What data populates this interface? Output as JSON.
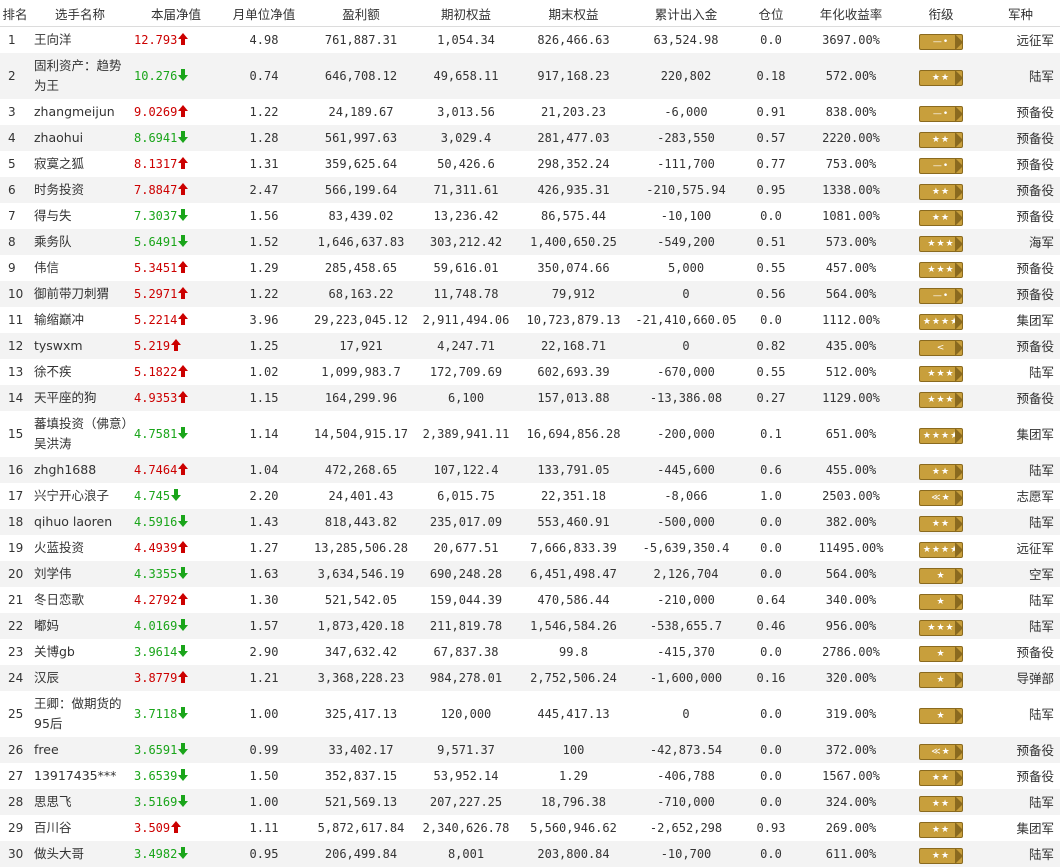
{
  "headers": [
    "排名",
    "选手名称",
    "本届净值",
    "月单位净值",
    "盈利额",
    "期初权益",
    "期末权益",
    "累计出入金",
    "仓位",
    "年化收益率",
    "衔级",
    "军种"
  ],
  "colors": {
    "up": "#cc0000",
    "down": "#1aa51a",
    "badge": "#c89f3c"
  },
  "rows": [
    {
      "rank": "1",
      "name": "王向洋",
      "nav": "12.793",
      "dir": "up",
      "monthly": "4.98",
      "profit": "761,887.31",
      "start": "1,054.34",
      "end": "826,466.63",
      "flow": "63,524.98",
      "position": "0.0",
      "annual": "3697.00%",
      "badge": "—•",
      "service": "远征军"
    },
    {
      "rank": "2",
      "name": "固利资产：趋势为王",
      "nav": "10.276",
      "dir": "down",
      "monthly": "0.74",
      "profit": "646,708.12",
      "start": "49,658.11",
      "end": "917,168.23",
      "flow": "220,802",
      "position": "0.18",
      "annual": "572.00%",
      "badge": "★★",
      "service": "陆军"
    },
    {
      "rank": "3",
      "name": "zhangmeijun",
      "nav": "9.0269",
      "dir": "up",
      "monthly": "1.22",
      "profit": "24,189.67",
      "start": "3,013.56",
      "end": "21,203.23",
      "flow": "-6,000",
      "position": "0.91",
      "annual": "838.00%",
      "badge": "—•",
      "service": "预备役"
    },
    {
      "rank": "4",
      "name": "zhaohui",
      "nav": "8.6941",
      "dir": "down",
      "monthly": "1.28",
      "profit": "561,997.63",
      "start": "3,029.4",
      "end": "281,477.03",
      "flow": "-283,550",
      "position": "0.57",
      "annual": "2220.00%",
      "badge": "★★",
      "service": "预备役"
    },
    {
      "rank": "5",
      "name": "寂寞之狐",
      "nav": "8.1317",
      "dir": "up",
      "monthly": "1.31",
      "profit": "359,625.64",
      "start": "50,426.6",
      "end": "298,352.24",
      "flow": "-111,700",
      "position": "0.77",
      "annual": "753.00%",
      "badge": "—•",
      "service": "预备役"
    },
    {
      "rank": "6",
      "name": "时务投资",
      "nav": "7.8847",
      "dir": "up",
      "monthly": "2.47",
      "profit": "566,199.64",
      "start": "71,311.61",
      "end": "426,935.31",
      "flow": "-210,575.94",
      "position": "0.95",
      "annual": "1338.00%",
      "badge": "★★",
      "service": "预备役"
    },
    {
      "rank": "7",
      "name": "得与失",
      "nav": "7.3037",
      "dir": "down",
      "monthly": "1.56",
      "profit": "83,439.02",
      "start": "13,236.42",
      "end": "86,575.44",
      "flow": "-10,100",
      "position": "0.0",
      "annual": "1081.00%",
      "badge": "★★",
      "service": "预备役"
    },
    {
      "rank": "8",
      "name": "乘务队",
      "nav": "5.6491",
      "dir": "down",
      "monthly": "1.52",
      "profit": "1,646,637.83",
      "start": "303,212.42",
      "end": "1,400,650.25",
      "flow": "-549,200",
      "position": "0.51",
      "annual": "573.00%",
      "badge": "★★★",
      "service": "海军"
    },
    {
      "rank": "9",
      "name": "伟信",
      "nav": "5.3451",
      "dir": "up",
      "monthly": "1.29",
      "profit": "285,458.65",
      "start": "59,616.01",
      "end": "350,074.66",
      "flow": "5,000",
      "position": "0.55",
      "annual": "457.00%",
      "badge": "★★★",
      "service": "预备役"
    },
    {
      "rank": "10",
      "name": "御前带刀刺猬",
      "nav": "5.2971",
      "dir": "up",
      "monthly": "1.22",
      "profit": "68,163.22",
      "start": "11,748.78",
      "end": "79,912",
      "flow": "0",
      "position": "0.56",
      "annual": "564.00%",
      "badge": "—•",
      "service": "预备役"
    },
    {
      "rank": "11",
      "name": "输缩巅冲",
      "nav": "5.2214",
      "dir": "up",
      "monthly": "3.96",
      "profit": "29,223,045.12",
      "start": "2,911,494.06",
      "end": "10,723,879.13",
      "flow": "-21,410,660.05",
      "position": "0.0",
      "annual": "1112.00%",
      "badge": "★★★★",
      "service": "集团军"
    },
    {
      "rank": "12",
      "name": "tyswxm",
      "nav": "5.219",
      "dir": "up",
      "monthly": "1.25",
      "profit": "17,921",
      "start": "4,247.71",
      "end": "22,168.71",
      "flow": "0",
      "position": "0.82",
      "annual": "435.00%",
      "badge": "<",
      "service": "预备役"
    },
    {
      "rank": "13",
      "name": "徐不疾",
      "nav": "5.1822",
      "dir": "up",
      "monthly": "1.02",
      "profit": "1,099,983.7",
      "start": "172,709.69",
      "end": "602,693.39",
      "flow": "-670,000",
      "position": "0.55",
      "annual": "512.00%",
      "badge": "★★★",
      "service": "陆军"
    },
    {
      "rank": "14",
      "name": "天平座的狗",
      "nav": "4.9353",
      "dir": "up",
      "monthly": "1.15",
      "profit": "164,299.96",
      "start": "6,100",
      "end": "157,013.88",
      "flow": "-13,386.08",
      "position": "0.27",
      "annual": "1129.00%",
      "badge": "★★★",
      "service": "预备役"
    },
    {
      "rank": "15",
      "name": "蕃填投资（佛意）吴洪涛",
      "nav": "4.7581",
      "dir": "down",
      "monthly": "1.14",
      "profit": "14,504,915.17",
      "start": "2,389,941.11",
      "end": "16,694,856.28",
      "flow": "-200,000",
      "position": "0.1",
      "annual": "651.00%",
      "badge": "★★★★",
      "service": "集团军"
    },
    {
      "rank": "16",
      "name": "zhgh1688",
      "nav": "4.7464",
      "dir": "up",
      "monthly": "1.04",
      "profit": "472,268.65",
      "start": "107,122.4",
      "end": "133,791.05",
      "flow": "-445,600",
      "position": "0.6",
      "annual": "455.00%",
      "badge": "★★",
      "service": "陆军"
    },
    {
      "rank": "17",
      "name": "兴宁开心浪子",
      "nav": "4.745",
      "dir": "down",
      "monthly": "2.20",
      "profit": "24,401.43",
      "start": "6,015.75",
      "end": "22,351.18",
      "flow": "-8,066",
      "position": "1.0",
      "annual": "2503.00%",
      "badge": "≪★",
      "service": "志愿军"
    },
    {
      "rank": "18",
      "name": "qihuo laoren",
      "nav": "4.5916",
      "dir": "down",
      "monthly": "1.43",
      "profit": "818,443.82",
      "start": "235,017.09",
      "end": "553,460.91",
      "flow": "-500,000",
      "position": "0.0",
      "annual": "382.00%",
      "badge": "★★",
      "service": "陆军"
    },
    {
      "rank": "19",
      "name": "火蓝投资",
      "nav": "4.4939",
      "dir": "up",
      "monthly": "1.27",
      "profit": "13,285,506.28",
      "start": "20,677.51",
      "end": "7,666,833.39",
      "flow": "-5,639,350.4",
      "position": "0.0",
      "annual": "11495.00%",
      "badge": "★★★★",
      "service": "远征军"
    },
    {
      "rank": "20",
      "name": "刘学伟",
      "nav": "4.3355",
      "dir": "down",
      "monthly": "1.63",
      "profit": "3,634,546.19",
      "start": "690,248.28",
      "end": "6,451,498.47",
      "flow": "2,126,704",
      "position": "0.0",
      "annual": "564.00%",
      "badge": "★",
      "service": "空军"
    },
    {
      "rank": "21",
      "name": "冬日恋歌",
      "nav": "4.2792",
      "dir": "up",
      "monthly": "1.30",
      "profit": "521,542.05",
      "start": "159,044.39",
      "end": "470,586.44",
      "flow": "-210,000",
      "position": "0.64",
      "annual": "340.00%",
      "badge": "★",
      "service": "陆军"
    },
    {
      "rank": "22",
      "name": "嘟妈",
      "nav": "4.0169",
      "dir": "down",
      "monthly": "1.57",
      "profit": "1,873,420.18",
      "start": "211,819.78",
      "end": "1,546,584.26",
      "flow": "-538,655.7",
      "position": "0.46",
      "annual": "956.00%",
      "badge": "★★★",
      "service": "陆军"
    },
    {
      "rank": "23",
      "name": "关博gb",
      "nav": "3.9614",
      "dir": "down",
      "monthly": "2.90",
      "profit": "347,632.42",
      "start": "67,837.38",
      "end": "99.8",
      "flow": "-415,370",
      "position": "0.0",
      "annual": "2786.00%",
      "badge": "★",
      "service": "预备役"
    },
    {
      "rank": "24",
      "name": "汉辰",
      "nav": "3.8779",
      "dir": "up",
      "monthly": "1.21",
      "profit": "3,368,228.23",
      "start": "984,278.01",
      "end": "2,752,506.24",
      "flow": "-1,600,000",
      "position": "0.16",
      "annual": "320.00%",
      "badge": "★",
      "service": "导弹部"
    },
    {
      "rank": "25",
      "name": "王卿：做期货的95后",
      "nav": "3.7118",
      "dir": "down",
      "monthly": "1.00",
      "profit": "325,417.13",
      "start": "120,000",
      "end": "445,417.13",
      "flow": "0",
      "position": "0.0",
      "annual": "319.00%",
      "badge": "★",
      "service": "陆军"
    },
    {
      "rank": "26",
      "name": "free",
      "nav": "3.6591",
      "dir": "down",
      "monthly": "0.99",
      "profit": "33,402.17",
      "start": "9,571.37",
      "end": "100",
      "flow": "-42,873.54",
      "position": "0.0",
      "annual": "372.00%",
      "badge": "≪★",
      "service": "预备役"
    },
    {
      "rank": "27",
      "name": "13917435***",
      "nav": "3.6539",
      "dir": "down",
      "monthly": "1.50",
      "profit": "352,837.15",
      "start": "53,952.14",
      "end": "1.29",
      "flow": "-406,788",
      "position": "0.0",
      "annual": "1567.00%",
      "badge": "★★",
      "service": "预备役"
    },
    {
      "rank": "28",
      "name": "思思飞",
      "nav": "3.5169",
      "dir": "down",
      "monthly": "1.00",
      "profit": "521,569.13",
      "start": "207,227.25",
      "end": "18,796.38",
      "flow": "-710,000",
      "position": "0.0",
      "annual": "324.00%",
      "badge": "★★",
      "service": "陆军"
    },
    {
      "rank": "29",
      "name": "百川谷",
      "nav": "3.509",
      "dir": "up",
      "monthly": "1.11",
      "profit": "5,872,617.84",
      "start": "2,340,626.78",
      "end": "5,560,946.62",
      "flow": "-2,652,298",
      "position": "0.93",
      "annual": "269.00%",
      "badge": "★★",
      "service": "集团军"
    },
    {
      "rank": "30",
      "name": "做头大哥",
      "nav": "3.4982",
      "dir": "down",
      "monthly": "0.95",
      "profit": "206,499.84",
      "start": "8,001",
      "end": "203,800.84",
      "flow": "-10,700",
      "position": "0.0",
      "annual": "611.00%",
      "badge": "★★",
      "service": "陆军"
    }
  ]
}
